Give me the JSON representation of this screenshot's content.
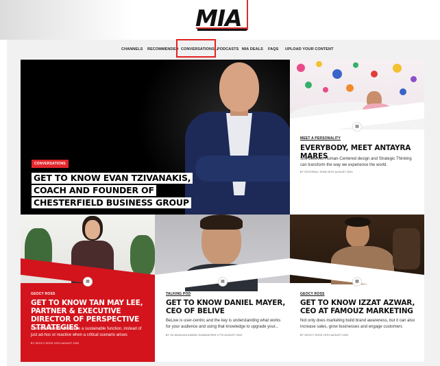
{
  "header": {
    "logo": "MIA"
  },
  "nav": {
    "items": [
      {
        "label": "CHANNELS"
      },
      {
        "label": "RECOMMENDED"
      },
      {
        "label": "CONVERSATIONS ⌄"
      },
      {
        "label": "PODCASTS"
      },
      {
        "label": "MIA DEALS"
      },
      {
        "label": "FAQS"
      },
      {
        "label": "UPLOAD YOUR CONTENT"
      }
    ]
  },
  "hero": {
    "badge": "CONVERSATIONS",
    "title_lines": [
      "GET TO KNOW EVAN TZIVANAKIS,",
      "COACH AND FOUNDER OF",
      "CHESTERFIELD BUSINESS GROUP"
    ]
  },
  "cards": [
    {
      "category": "MEET A PERSONALITY",
      "title": "EVERYBODY, MEET ANTAYRA MARES",
      "excerpt": "She believes Human-Centered design and Strategic Thinking can transform the way we experience the world.",
      "meta": "BY EDITORIAL TEAM    26TH AUGUST 2020"
    },
    {
      "category": "GEOCY ROSS",
      "title": "GET TO KNOW TAN MAY LEE, PARTNER & EXECUTIVE DIRECTOR OF PERSPECTIVE STRATEGIES",
      "excerpt": "Communications should be a sustainable function, instead of just ad-hoc or reactive when a critical scenario arises",
      "meta": "BY GEOCY ROSS    24TH AUGUST 2020"
    },
    {
      "category": "TALKING POD",
      "title": "GET TO KNOW DANIEL MAYER, CEO OF BELIVE",
      "excerpt": "BeLive is user-centric and the key is understanding what works for your audience and using that knowledge to upgrade your...",
      "meta": "BY SU ANJALIKA KAMUD GUNAVATHEN    17TH AUGUST 2020"
    },
    {
      "category": "GEOCY ROSS",
      "title": "GET TO KNOW IZZAT AZWAR, CEO AT FAMOUZ MARKETING",
      "excerpt": "Not only does marketing build brand awareness, but it can also increase sales, grow businesses and engage customers",
      "meta": "BY GEOCY ROSS    19TH AUGUST 2020"
    }
  ],
  "icons": {
    "article": "document-icon"
  },
  "colors": {
    "accent_red": "#e3262b",
    "card_red": "#d3141c"
  }
}
